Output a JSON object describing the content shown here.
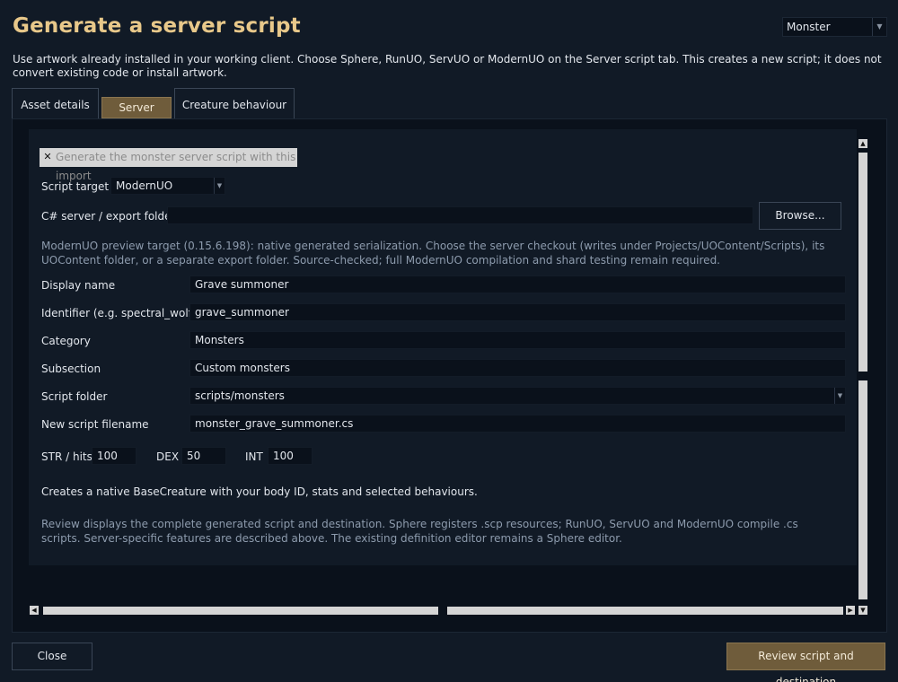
{
  "window": {
    "title": "Generate a server script",
    "type_select_value": "Monster",
    "intro": "Use artwork already installed in your working client. Choose Sphere, RunUO, ServUO or ModernUO on the Server script tab. This creates a new script; it does not convert existing code or install artwork."
  },
  "tabs": [
    {
      "label": "Asset details"
    },
    {
      "label": "Server script"
    },
    {
      "label": "Creature behaviour"
    }
  ],
  "form": {
    "generate_checkbox": {
      "label": "Generate the monster server script with this import",
      "checked": true
    },
    "script_target": {
      "label": "Script target",
      "value": "ModernUO"
    },
    "export_folder": {
      "label": "C# server / export folder",
      "value": "",
      "browse_label": "Browse..."
    },
    "target_note": "ModernUO preview target (0.15.6.198): native generated serialization. Choose the server checkout (writes under Projects/UOContent/Scripts), its UOContent folder, or a separate export folder. Source-checked; full ModernUO compilation and shard testing remain required.",
    "display_name": {
      "label": "Display name",
      "value": "Grave summoner"
    },
    "identifier": {
      "label": "Identifier (e.g. spectral_wolf)",
      "value": "grave_summoner"
    },
    "category": {
      "label": "Category",
      "value": "Monsters"
    },
    "subsection": {
      "label": "Subsection",
      "value": "Custom monsters"
    },
    "script_folder": {
      "label": "Script folder",
      "value": "scripts/monsters"
    },
    "filename": {
      "label": "New script filename",
      "value": "monster_grave_summoner.cs"
    },
    "stats": {
      "str_label": "STR / hits",
      "str_value": "100",
      "dex_label": "DEX",
      "dex_value": "50",
      "int_label": "INT",
      "int_value": "100"
    },
    "creates_note": "Creates a native BaseCreature with your body ID, stats and selected behaviours.",
    "review_note": "Review displays the complete generated script and destination. Sphere registers .scp resources; RunUO, ServUO and ModernUO compile .cs scripts. Server-specific features are described above. The existing definition editor remains a Sphere editor."
  },
  "footer": {
    "close_label": "Close",
    "review_label": "Review script and destination"
  },
  "colors": {
    "background": "#111a26",
    "field_background": "#0a111b",
    "title_accent": "#e8c88a",
    "active_accent": "#6f5c3b",
    "muted_text": "#8d9bad"
  }
}
